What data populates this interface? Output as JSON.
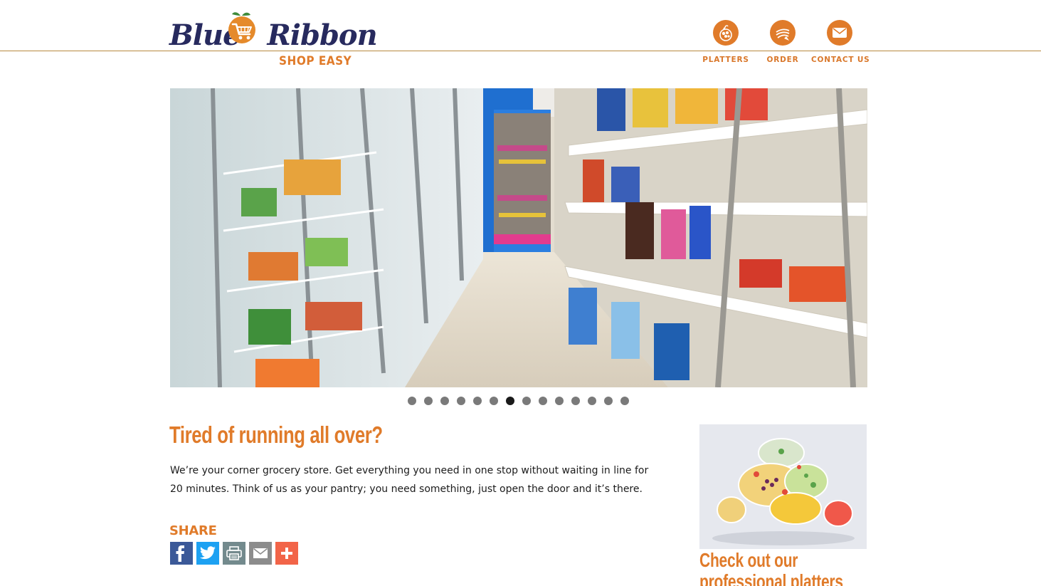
{
  "brand": {
    "name_part1": "Blue",
    "name_part2": "Ribbon",
    "tagline": "SHOP EASY",
    "colors": {
      "navy": "#272a5e",
      "orange": "#e07b2a",
      "rule": "#b7893f"
    }
  },
  "nav": {
    "items": [
      {
        "label": "PLATTERS",
        "icon": "platter-icon"
      },
      {
        "label": "ORDER",
        "icon": "order-icon"
      },
      {
        "label": "CONTACT US",
        "icon": "envelope-icon"
      }
    ]
  },
  "slider": {
    "slide_count": 14,
    "active_index": 6,
    "image": "grocery-aisle-photo"
  },
  "main": {
    "heading": "Tired of running all over?",
    "body": "We’re your corner grocery store. Get everything you need in one stop without waiting in line for 20 minutes. Think of us as your pantry; you need something, just open the door and it’s there."
  },
  "share": {
    "label": "SHARE",
    "buttons": [
      {
        "icon": "facebook-icon",
        "color": "#3b5998"
      },
      {
        "icon": "twitter-icon",
        "color": "#1da1f2"
      },
      {
        "icon": "print-icon",
        "color": "#738a8d"
      },
      {
        "icon": "email-icon",
        "color": "#8c8c8c"
      },
      {
        "icon": "plus-icon",
        "color": "#f26448"
      }
    ]
  },
  "sidebar": {
    "image": "fruit-platters-photo",
    "heading": "Check out our professional platters"
  }
}
